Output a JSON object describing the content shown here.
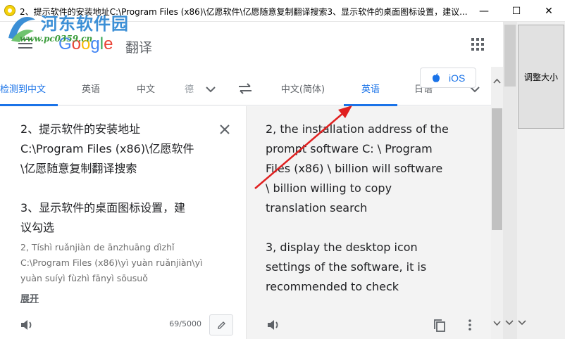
{
  "window": {
    "title": "2、提示软件的安装地址C:\\Program Files (x86)\\亿愿软件\\亿愿随意复制翻译搜索3、显示软件的桌面图标设置，建议...",
    "min_glyph": "—",
    "max_glyph": "☐",
    "close_glyph": "✕"
  },
  "watermark": {
    "top": "河东软件园",
    "bottom": "www.pc0359.cn"
  },
  "header": {
    "brand_letters": [
      "G",
      "o",
      "o",
      "g",
      "l",
      "e"
    ],
    "product": "翻译"
  },
  "languages": {
    "source_tabs": [
      "检测到中文",
      "英语",
      "中文",
      "德"
    ],
    "target_tabs": [
      "中文(简体)",
      "英语",
      "日语"
    ],
    "ios_label": "iOS"
  },
  "source": {
    "text": "2、提示软件的安装地址\nC:\\Program Files (x86)\\亿愿软件\n\\亿愿随意复制翻译搜索\n\n3、显示软件的桌面图标设置，建\n议勾选",
    "romanization": "2, Tíshì ruǎnjiàn de ānzhuāng dìzhǐ\nC:\\Program Files (x86)\\yì yuàn ruǎnjiàn\\yì\nyuàn suíyì fùzhì fānyì sōusuǒ",
    "expand_label": "展开",
    "char_count": "69/5000"
  },
  "target": {
    "text": "2, the installation address of the\nprompt software C: \\ Program\nFiles (x86) \\ billion will software\n\\ billion willing to copy\ntranslation search\n\n3, display the desktop icon\nsettings of the software, it is\nrecommended to check"
  },
  "side": {
    "resize_label": "调整大小"
  },
  "colors": {
    "accent": "#1a73e8",
    "target_bg": "#f3f3f3",
    "arrow": "#e02020"
  }
}
